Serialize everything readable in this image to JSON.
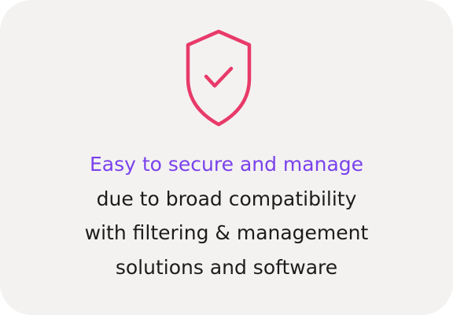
{
  "card": {
    "headline": "Easy to secure and manage",
    "body_lines": [
      "due to broad compatibility",
      "with filtering & management",
      "solutions and software"
    ]
  },
  "icon": {
    "name": "shield-check-icon",
    "color": "#e83a6a"
  },
  "colors": {
    "background": "#f4f2f1",
    "headline": "#7a41ec",
    "body": "#1c1c1c"
  }
}
